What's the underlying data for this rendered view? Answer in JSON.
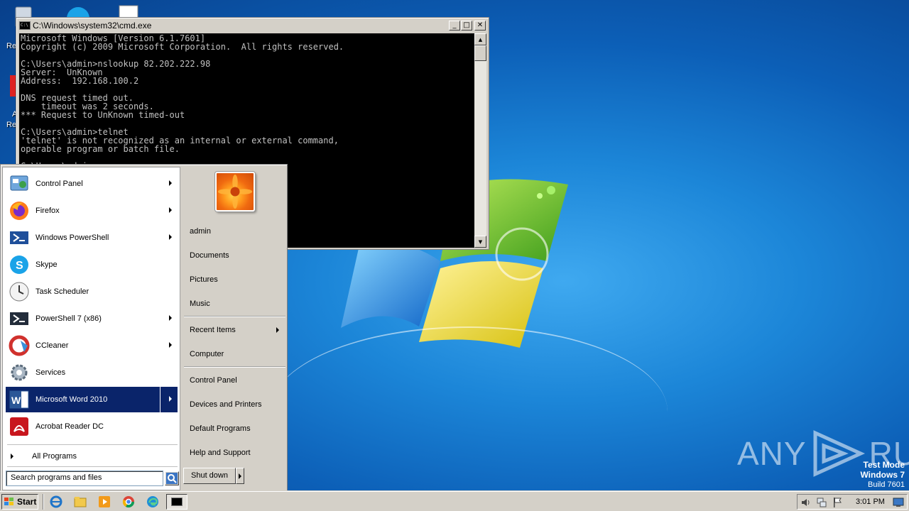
{
  "desktop": {
    "icon_labels": [
      "Re",
      "A",
      "Re"
    ]
  },
  "watermark": {
    "brand_left": "ANY",
    "brand_right": "RUN",
    "test_mode": "Test Mode",
    "os_name": "Windows 7",
    "build": "Build 7601"
  },
  "cmd": {
    "title": "C:\\Windows\\system32\\cmd.exe",
    "minimize": "_",
    "maximize": "□",
    "close": "✕",
    "lines": "Microsoft Windows [Version 6.1.7601]\nCopyright (c) 2009 Microsoft Corporation.  All rights reserved.\n\nC:\\Users\\admin>nslookup 82.202.222.98\nServer:  UnKnown\nAddress:  192.168.100.2\n\nDNS request timed out.\n    timeout was 2 seconds.\n*** Request to UnKnown timed-out\n\nC:\\Users\\admin>telnet\n'telnet' is not recognized as an internal or external command,\noperable program or batch file.\n\nC:\\Users\\admin>"
  },
  "start_menu": {
    "programs": [
      {
        "label": "Control Panel",
        "icon": "control-panel-icon",
        "submenu": true
      },
      {
        "label": "Firefox",
        "icon": "firefox-icon",
        "submenu": true
      },
      {
        "label": "Windows PowerShell",
        "icon": "powershell-icon",
        "submenu": true
      },
      {
        "label": "Skype",
        "icon": "skype-icon",
        "submenu": false
      },
      {
        "label": "Task Scheduler",
        "icon": "task-scheduler-icon",
        "submenu": false
      },
      {
        "label": "PowerShell 7 (x86)",
        "icon": "powershell7-icon",
        "submenu": true
      },
      {
        "label": "CCleaner",
        "icon": "ccleaner-icon",
        "submenu": true
      },
      {
        "label": "Services",
        "icon": "services-icon",
        "submenu": false
      },
      {
        "label": "Microsoft Word 2010",
        "icon": "word-icon",
        "submenu": true,
        "selected": true
      },
      {
        "label": "Acrobat Reader DC",
        "icon": "acrobat-icon",
        "submenu": false
      }
    ],
    "all_programs": "All Programs",
    "search_placeholder": "Search programs and files",
    "right_items": {
      "user": "admin",
      "documents": "Documents",
      "pictures": "Pictures",
      "music": "Music",
      "recent_items": "Recent Items",
      "computer": "Computer",
      "control_panel": "Control Panel",
      "devices_printers": "Devices and Printers",
      "default_programs": "Default Programs",
      "help_support": "Help and Support"
    },
    "shutdown": "Shut down"
  },
  "taskbar": {
    "start_label": "Start",
    "clock": "3:01 PM",
    "pinned": [
      "internet-explorer-icon",
      "explorer-icon",
      "media-player-icon",
      "chrome-icon",
      "edge-icon"
    ]
  },
  "colors": {
    "menu_highlight": "#0a246a",
    "classic_gray": "#d4d0c8",
    "console_bg": "#000000",
    "console_text": "#c0c0c0"
  }
}
